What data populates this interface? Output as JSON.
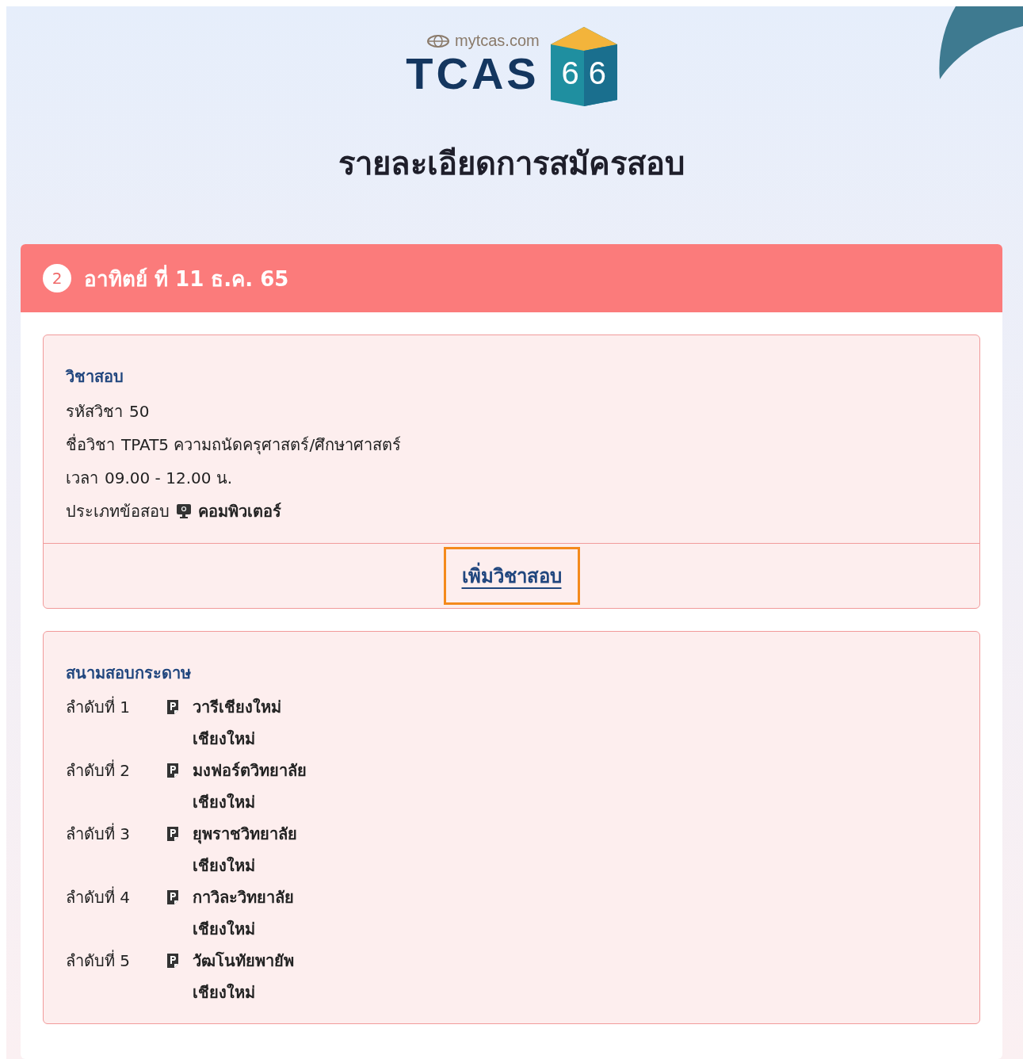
{
  "logo": {
    "site": "mytcas.com",
    "brand": "TCAS",
    "year_digits": [
      "6",
      "6"
    ]
  },
  "page_title": "รายละเอียดการสมัครสอบ",
  "exam_day": {
    "number": "2",
    "date": "อาทิตย์ ที่ 11 ธ.ค. 65",
    "subject": {
      "heading": "วิชาสอบ",
      "lines": [
        {
          "label": "รหัสวิชา",
          "value": "50",
          "kind": "text"
        },
        {
          "label": "ชื่อวิชา",
          "value": "TPAT5 ความถนัดครุศาสตร์/ศึกษาศาสตร์",
          "kind": "text"
        },
        {
          "label": "เวลา",
          "value": "09.00 - 12.00 น.",
          "kind": "text"
        },
        {
          "label": "ประเภทข้อสอบ",
          "value": "คอมพิวเตอร์",
          "kind": "computer"
        }
      ],
      "add_button": {
        "label": "เพิ่มวิชาสอบ",
        "focused": true
      }
    },
    "venues": {
      "heading": "สนามสอบกระดาษ",
      "items": [
        {
          "rank": "ลำดับที่ 1",
          "name": "วารีเชียงใหม่",
          "province": "เชียงใหม่"
        },
        {
          "rank": "ลำดับที่ 2",
          "name": "มงฟอร์ตวิทยาลัย",
          "province": "เชียงใหม่"
        },
        {
          "rank": "ลำดับที่ 3",
          "name": "ยุพราชวิทยาลัย",
          "province": "เชียงใหม่"
        },
        {
          "rank": "ลำดับที่ 4",
          "name": "กาวิละวิทยาลัย",
          "province": "เชียงใหม่"
        },
        {
          "rank": "ลำดับที่ 5",
          "name": "วัฒโนทัยพายัพ",
          "province": "เชียงใหม่"
        }
      ]
    }
  }
}
